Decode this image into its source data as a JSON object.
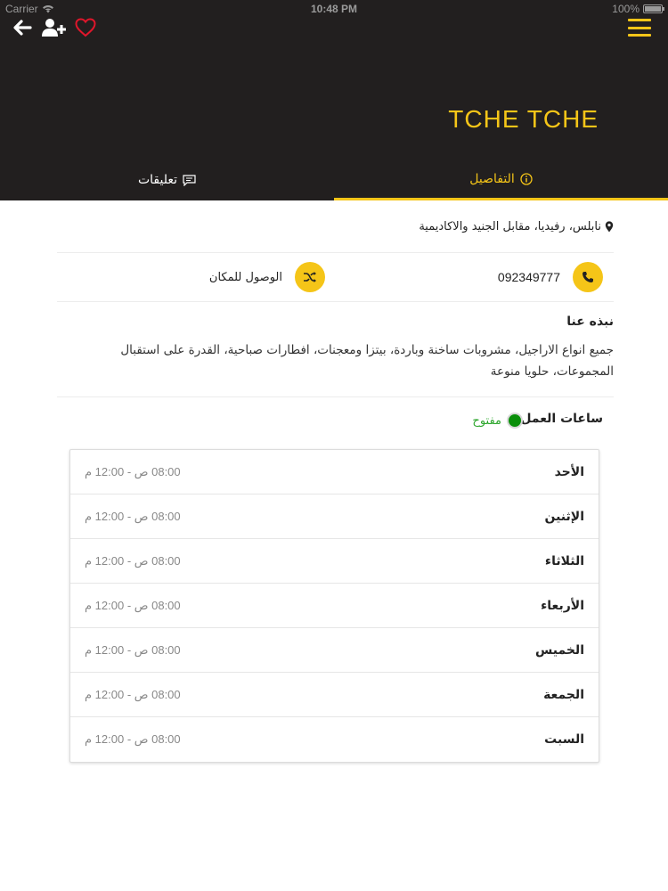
{
  "status_bar": {
    "carrier": "Carrier",
    "time": "10:48 PM",
    "battery": "100%"
  },
  "header": {
    "title": "TCHE TCHE",
    "icons": {
      "back": "arrow-left-icon",
      "add_user": "user-plus-icon",
      "favorite": "heart-outline-icon",
      "menu": "hamburger-menu-icon"
    }
  },
  "tabs": [
    {
      "label": "التفاصيل",
      "icon": "info-circle-icon",
      "active": true
    },
    {
      "label": "تعليقات",
      "icon": "comment-icon",
      "active": false
    }
  ],
  "details": {
    "address": "نابلس، رفيديا، مقابل الجنيد والاكاديمية",
    "phone": "092349777",
    "directions_label": "الوصول للمكان",
    "about_title": "نبذه عنا",
    "about_text": "جميع انواع الاراجيل، مشروبات ساخنة وباردة، بيتزا ومعجنات، افطارات صباحية، القدرة على استقبال المجموعات، حلويا منوعة",
    "hours_title": "ساعات العمل",
    "open_status": "مفتوح"
  },
  "hours": [
    {
      "day": "الأحد",
      "time": "08:00 ص - 12:00 م"
    },
    {
      "day": "الإثنين",
      "time": "08:00 ص - 12:00 م"
    },
    {
      "day": "الثلاثاء",
      "time": "08:00 ص - 12:00 م"
    },
    {
      "day": "الأربعاء",
      "time": "08:00 ص - 12:00 م"
    },
    {
      "day": "الخميس",
      "time": "08:00 ص - 12:00 م"
    },
    {
      "day": "الجمعة",
      "time": "08:00 ص - 12:00 م"
    },
    {
      "day": "السبت",
      "time": "08:00 ص - 12:00 م"
    }
  ],
  "colors": {
    "accent": "#f5c518",
    "header_bg": "#221f1f",
    "open_green": "#0a8f0a"
  }
}
